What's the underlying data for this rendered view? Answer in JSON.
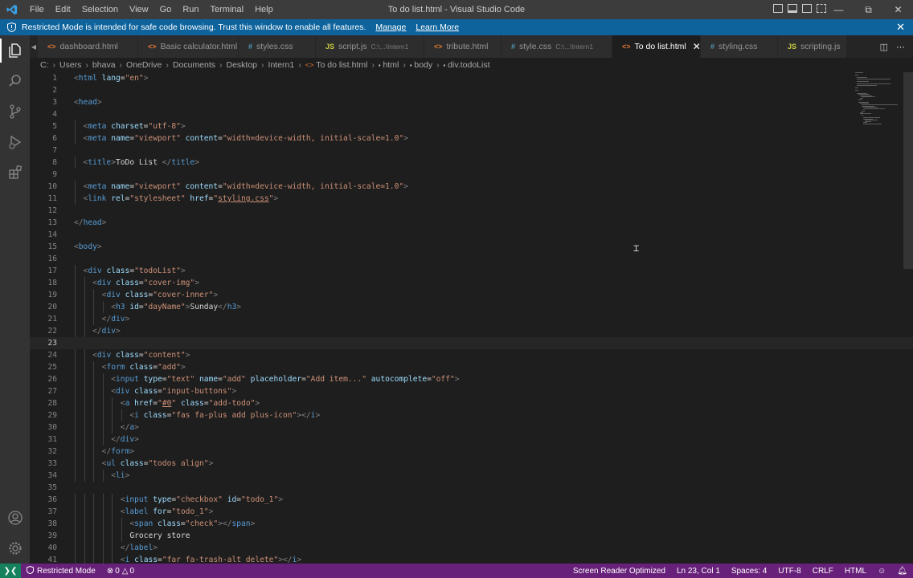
{
  "menu": [
    "File",
    "Edit",
    "Selection",
    "View",
    "Go",
    "Run",
    "Terminal",
    "Help"
  ],
  "window_title": "To do list.html - Visual Studio Code",
  "banner": {
    "message": "Restricted Mode is intended for safe code browsing. Trust this window to enable all features.",
    "manage": "Manage",
    "learn_more": "Learn More"
  },
  "tabs": [
    {
      "label": "dashboard.html",
      "icon": "<>",
      "color": "#e37933",
      "desc": "",
      "width": 125
    },
    {
      "label": "Basic calculator.html",
      "icon": "<>",
      "color": "#e37933",
      "desc": "",
      "width": 125
    },
    {
      "label": "styles.css",
      "icon": "#",
      "color": "#519aba",
      "desc": "",
      "width": 96
    },
    {
      "label": "script.js",
      "icon": "JS",
      "color": "#cbcb41",
      "desc": "C:\\...\\Intern1",
      "width": 135
    },
    {
      "label": "tribute.html",
      "icon": "<>",
      "color": "#e37933",
      "desc": "",
      "width": 96
    },
    {
      "label": "style.css",
      "icon": "#",
      "color": "#519aba",
      "desc": "C:\\...\\Intern1",
      "width": 138
    },
    {
      "label": "To do list.html",
      "icon": "<>",
      "color": "#e37933",
      "desc": "",
      "width": 110,
      "active": true
    },
    {
      "label": "styling.css",
      "icon": "#",
      "color": "#519aba",
      "desc": "",
      "width": 96
    },
    {
      "label": "scripting.js",
      "icon": "JS",
      "color": "#cbcb41",
      "desc": "",
      "width": 86
    }
  ],
  "breadcrumb": [
    "C:",
    "Users",
    "bhava",
    "OneDrive",
    "Documents",
    "Desktop",
    "Intern1",
    "To do list.html",
    "html",
    "body",
    "div.todoList"
  ],
  "editor": {
    "current_line": 23,
    "lines": [
      {
        "n": 1,
        "i": 0,
        "t": [
          [
            "br",
            "<"
          ],
          [
            "tag",
            "html"
          ],
          [
            "txt",
            " "
          ],
          [
            "attr",
            "lang"
          ],
          [
            "txt",
            "="
          ],
          [
            "str",
            "\"en\""
          ],
          [
            "br",
            ">"
          ]
        ]
      },
      {
        "n": 2,
        "i": 0,
        "t": []
      },
      {
        "n": 3,
        "i": 0,
        "t": [
          [
            "br",
            "<"
          ],
          [
            "tag",
            "head"
          ],
          [
            "br",
            ">"
          ]
        ]
      },
      {
        "n": 4,
        "i": 0,
        "t": []
      },
      {
        "n": 5,
        "i": 1,
        "t": [
          [
            "br",
            "<"
          ],
          [
            "tag",
            "meta"
          ],
          [
            "txt",
            " "
          ],
          [
            "attr",
            "charset"
          ],
          [
            "txt",
            "="
          ],
          [
            "str",
            "\"utf-8\""
          ],
          [
            "br",
            ">"
          ]
        ]
      },
      {
        "n": 6,
        "i": 1,
        "t": [
          [
            "br",
            "<"
          ],
          [
            "tag",
            "meta"
          ],
          [
            "txt",
            " "
          ],
          [
            "attr",
            "name"
          ],
          [
            "txt",
            "="
          ],
          [
            "str",
            "\"viewport\""
          ],
          [
            "txt",
            " "
          ],
          [
            "attr",
            "content"
          ],
          [
            "txt",
            "="
          ],
          [
            "str",
            "\"width=device-width, initial-scale=1.0\""
          ],
          [
            "br",
            ">"
          ]
        ]
      },
      {
        "n": 7,
        "i": 0,
        "t": []
      },
      {
        "n": 8,
        "i": 1,
        "t": [
          [
            "br",
            "<"
          ],
          [
            "tag",
            "title"
          ],
          [
            "br",
            ">"
          ],
          [
            "txt",
            "ToDo List "
          ],
          [
            "br",
            "</"
          ],
          [
            "tag",
            "title"
          ],
          [
            "br",
            ">"
          ]
        ]
      },
      {
        "n": 9,
        "i": 0,
        "t": []
      },
      {
        "n": 10,
        "i": 1,
        "t": [
          [
            "br",
            "<"
          ],
          [
            "tag",
            "meta"
          ],
          [
            "txt",
            " "
          ],
          [
            "attr",
            "name"
          ],
          [
            "txt",
            "="
          ],
          [
            "str",
            "\"viewport\""
          ],
          [
            "txt",
            " "
          ],
          [
            "attr",
            "content"
          ],
          [
            "txt",
            "="
          ],
          [
            "str",
            "\"width=device-width, initial-scale=1.0\""
          ],
          [
            "br",
            ">"
          ]
        ]
      },
      {
        "n": 11,
        "i": 1,
        "t": [
          [
            "br",
            "<"
          ],
          [
            "tag",
            "link"
          ],
          [
            "txt",
            " "
          ],
          [
            "attr",
            "rel"
          ],
          [
            "txt",
            "="
          ],
          [
            "str",
            "\"stylesheet\""
          ],
          [
            "txt",
            " "
          ],
          [
            "attr",
            "href"
          ],
          [
            "txt",
            "="
          ],
          [
            "str",
            "\""
          ],
          [
            "strul",
            "styling.css"
          ],
          [
            "str",
            "\""
          ],
          [
            "br",
            ">"
          ]
        ]
      },
      {
        "n": 12,
        "i": 0,
        "t": []
      },
      {
        "n": 13,
        "i": 0,
        "t": [
          [
            "br",
            "</"
          ],
          [
            "tag",
            "head"
          ],
          [
            "br",
            ">"
          ]
        ]
      },
      {
        "n": 14,
        "i": 0,
        "t": []
      },
      {
        "n": 15,
        "i": 0,
        "t": [
          [
            "br",
            "<"
          ],
          [
            "tag",
            "body"
          ],
          [
            "br",
            ">"
          ]
        ]
      },
      {
        "n": 16,
        "i": 0,
        "t": []
      },
      {
        "n": 17,
        "i": 1,
        "t": [
          [
            "br",
            "<"
          ],
          [
            "tag",
            "div"
          ],
          [
            "txt",
            " "
          ],
          [
            "attr",
            "class"
          ],
          [
            "txt",
            "="
          ],
          [
            "str",
            "\"todoList\""
          ],
          [
            "br",
            ">"
          ]
        ]
      },
      {
        "n": 18,
        "i": 2,
        "t": [
          [
            "br",
            "<"
          ],
          [
            "tag",
            "div"
          ],
          [
            "txt",
            " "
          ],
          [
            "attr",
            "class"
          ],
          [
            "txt",
            "="
          ],
          [
            "str",
            "\"cover-img\""
          ],
          [
            "br",
            ">"
          ]
        ]
      },
      {
        "n": 19,
        "i": 3,
        "t": [
          [
            "br",
            "<"
          ],
          [
            "tag",
            "div"
          ],
          [
            "txt",
            " "
          ],
          [
            "attr",
            "class"
          ],
          [
            "txt",
            "="
          ],
          [
            "str",
            "\"cover-inner\""
          ],
          [
            "br",
            ">"
          ]
        ]
      },
      {
        "n": 20,
        "i": 4,
        "t": [
          [
            "br",
            "<"
          ],
          [
            "tag",
            "h3"
          ],
          [
            "txt",
            " "
          ],
          [
            "attr",
            "id"
          ],
          [
            "txt",
            "="
          ],
          [
            "str",
            "\"dayName\""
          ],
          [
            "br",
            ">"
          ],
          [
            "txt",
            "Sunday"
          ],
          [
            "br",
            "</"
          ],
          [
            "tag",
            "h3"
          ],
          [
            "br",
            ">"
          ]
        ]
      },
      {
        "n": 21,
        "i": 3,
        "t": [
          [
            "br",
            "</"
          ],
          [
            "tag",
            "div"
          ],
          [
            "br",
            ">"
          ]
        ]
      },
      {
        "n": 22,
        "i": 2,
        "t": [
          [
            "br",
            "</"
          ],
          [
            "tag",
            "div"
          ],
          [
            "br",
            ">"
          ]
        ]
      },
      {
        "n": 23,
        "i": 0,
        "t": []
      },
      {
        "n": 24,
        "i": 2,
        "t": [
          [
            "br",
            "<"
          ],
          [
            "tag",
            "div"
          ],
          [
            "txt",
            " "
          ],
          [
            "attr",
            "class"
          ],
          [
            "txt",
            "="
          ],
          [
            "str",
            "\"content\""
          ],
          [
            "br",
            ">"
          ]
        ]
      },
      {
        "n": 25,
        "i": 3,
        "t": [
          [
            "br",
            "<"
          ],
          [
            "tag",
            "form"
          ],
          [
            "txt",
            " "
          ],
          [
            "attr",
            "class"
          ],
          [
            "txt",
            "="
          ],
          [
            "str",
            "\"add\""
          ],
          [
            "br",
            ">"
          ]
        ]
      },
      {
        "n": 26,
        "i": 4,
        "t": [
          [
            "br",
            "<"
          ],
          [
            "tag",
            "input"
          ],
          [
            "txt",
            " "
          ],
          [
            "attr",
            "type"
          ],
          [
            "txt",
            "="
          ],
          [
            "str",
            "\"text\""
          ],
          [
            "txt",
            " "
          ],
          [
            "attr",
            "name"
          ],
          [
            "txt",
            "="
          ],
          [
            "str",
            "\"add\""
          ],
          [
            "txt",
            " "
          ],
          [
            "attr",
            "placeholder"
          ],
          [
            "txt",
            "="
          ],
          [
            "str",
            "\"Add item...\""
          ],
          [
            "txt",
            " "
          ],
          [
            "attr",
            "autocomplete"
          ],
          [
            "txt",
            "="
          ],
          [
            "str",
            "\"off\""
          ],
          [
            "br",
            ">"
          ]
        ]
      },
      {
        "n": 27,
        "i": 4,
        "t": [
          [
            "br",
            "<"
          ],
          [
            "tag",
            "div"
          ],
          [
            "txt",
            " "
          ],
          [
            "attr",
            "class"
          ],
          [
            "txt",
            "="
          ],
          [
            "str",
            "\"input-buttons\""
          ],
          [
            "br",
            ">"
          ]
        ]
      },
      {
        "n": 28,
        "i": 5,
        "t": [
          [
            "br",
            "<"
          ],
          [
            "tag",
            "a"
          ],
          [
            "txt",
            " "
          ],
          [
            "attr",
            "href"
          ],
          [
            "txt",
            "="
          ],
          [
            "str",
            "\""
          ],
          [
            "strul",
            "#0"
          ],
          [
            "str",
            "\""
          ],
          [
            "txt",
            " "
          ],
          [
            "attr",
            "class"
          ],
          [
            "txt",
            "="
          ],
          [
            "str",
            "\"add-todo\""
          ],
          [
            "br",
            ">"
          ]
        ]
      },
      {
        "n": 29,
        "i": 6,
        "t": [
          [
            "br",
            "<"
          ],
          [
            "tag",
            "i"
          ],
          [
            "txt",
            " "
          ],
          [
            "attr",
            "class"
          ],
          [
            "txt",
            "="
          ],
          [
            "str",
            "\"fas fa-plus add plus-icon\""
          ],
          [
            "br",
            ">"
          ],
          [
            "br",
            "</"
          ],
          [
            "tag",
            "i"
          ],
          [
            "br",
            ">"
          ]
        ]
      },
      {
        "n": 30,
        "i": 5,
        "t": [
          [
            "br",
            "</"
          ],
          [
            "tag",
            "a"
          ],
          [
            "br",
            ">"
          ]
        ]
      },
      {
        "n": 31,
        "i": 4,
        "t": [
          [
            "br",
            "</"
          ],
          [
            "tag",
            "div"
          ],
          [
            "br",
            ">"
          ]
        ]
      },
      {
        "n": 32,
        "i": 3,
        "t": [
          [
            "br",
            "</"
          ],
          [
            "tag",
            "form"
          ],
          [
            "br",
            ">"
          ]
        ]
      },
      {
        "n": 33,
        "i": 3,
        "t": [
          [
            "br",
            "<"
          ],
          [
            "tag",
            "ul"
          ],
          [
            "txt",
            " "
          ],
          [
            "attr",
            "class"
          ],
          [
            "txt",
            "="
          ],
          [
            "str",
            "\"todos align\""
          ],
          [
            "br",
            ">"
          ]
        ]
      },
      {
        "n": 34,
        "i": 4,
        "t": [
          [
            "br",
            "<"
          ],
          [
            "tag",
            "li"
          ],
          [
            "br",
            ">"
          ]
        ]
      },
      {
        "n": 35,
        "i": 0,
        "t": []
      },
      {
        "n": 36,
        "i": 5,
        "t": [
          [
            "br",
            "<"
          ],
          [
            "tag",
            "input"
          ],
          [
            "txt",
            " "
          ],
          [
            "attr",
            "type"
          ],
          [
            "txt",
            "="
          ],
          [
            "str",
            "\"checkbox\""
          ],
          [
            "txt",
            " "
          ],
          [
            "attr",
            "id"
          ],
          [
            "txt",
            "="
          ],
          [
            "str",
            "\"todo_1\""
          ],
          [
            "br",
            ">"
          ]
        ]
      },
      {
        "n": 37,
        "i": 5,
        "t": [
          [
            "br",
            "<"
          ],
          [
            "tag",
            "label"
          ],
          [
            "txt",
            " "
          ],
          [
            "attr",
            "for"
          ],
          [
            "txt",
            "="
          ],
          [
            "str",
            "\"todo_1\""
          ],
          [
            "br",
            ">"
          ]
        ]
      },
      {
        "n": 38,
        "i": 6,
        "t": [
          [
            "br",
            "<"
          ],
          [
            "tag",
            "span"
          ],
          [
            "txt",
            " "
          ],
          [
            "attr",
            "class"
          ],
          [
            "txt",
            "="
          ],
          [
            "str",
            "\"check\""
          ],
          [
            "br",
            ">"
          ],
          [
            "br",
            "</"
          ],
          [
            "tag",
            "span"
          ],
          [
            "br",
            ">"
          ]
        ]
      },
      {
        "n": 39,
        "i": 6,
        "t": [
          [
            "txt",
            "Grocery store"
          ]
        ]
      },
      {
        "n": 40,
        "i": 5,
        "t": [
          [
            "br",
            "</"
          ],
          [
            "tag",
            "label"
          ],
          [
            "br",
            ">"
          ]
        ]
      },
      {
        "n": 41,
        "i": 5,
        "t": [
          [
            "br",
            "<"
          ],
          [
            "tag",
            "i"
          ],
          [
            "txt",
            " "
          ],
          [
            "attr",
            "class"
          ],
          [
            "txt",
            "="
          ],
          [
            "str",
            "\"far fa-trash-alt delete\""
          ],
          [
            "br",
            ">"
          ],
          [
            "br",
            "</"
          ],
          [
            "tag",
            "i"
          ],
          [
            "br",
            ">"
          ]
        ]
      }
    ]
  },
  "status": {
    "restricted": "Restricted Mode",
    "errors": "0",
    "warnings": "0",
    "screen_reader": "Screen Reader Optimized",
    "position": "Ln 23, Col 1",
    "spaces": "Spaces: 4",
    "encoding": "UTF-8",
    "eol": "CRLF",
    "language": "HTML"
  },
  "colors": {
    "status_bar": "#68217a",
    "banner": "#0e639c",
    "remote": "#16825d"
  }
}
